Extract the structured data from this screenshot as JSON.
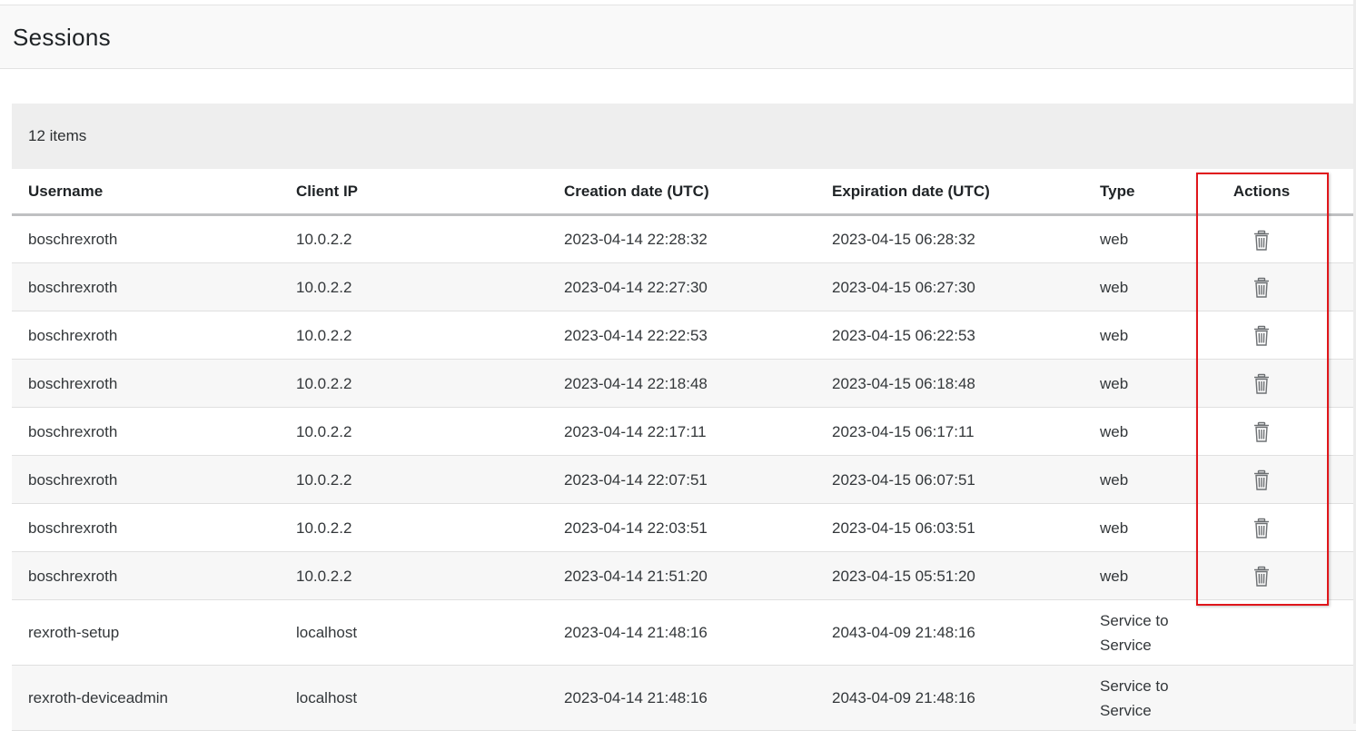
{
  "page": {
    "title": "Sessions"
  },
  "table": {
    "item_count": "12 items",
    "columns": [
      "Username",
      "Client IP",
      "Creation date (UTC)",
      "Expiration date (UTC)",
      "Type",
      "Actions"
    ],
    "rows": [
      {
        "username": "boschrexroth",
        "client_ip": "10.0.2.2",
        "created": "2023-04-14 22:28:32",
        "expires": "2023-04-15 06:28:32",
        "type": "web",
        "delete": true
      },
      {
        "username": "boschrexroth",
        "client_ip": "10.0.2.2",
        "created": "2023-04-14 22:27:30",
        "expires": "2023-04-15 06:27:30",
        "type": "web",
        "delete": true
      },
      {
        "username": "boschrexroth",
        "client_ip": "10.0.2.2",
        "created": "2023-04-14 22:22:53",
        "expires": "2023-04-15 06:22:53",
        "type": "web",
        "delete": true
      },
      {
        "username": "boschrexroth",
        "client_ip": "10.0.2.2",
        "created": "2023-04-14 22:18:48",
        "expires": "2023-04-15 06:18:48",
        "type": "web",
        "delete": true
      },
      {
        "username": "boschrexroth",
        "client_ip": "10.0.2.2",
        "created": "2023-04-14 22:17:11",
        "expires": "2023-04-15 06:17:11",
        "type": "web",
        "delete": true
      },
      {
        "username": "boschrexroth",
        "client_ip": "10.0.2.2",
        "created": "2023-04-14 22:07:51",
        "expires": "2023-04-15 06:07:51",
        "type": "web",
        "delete": true
      },
      {
        "username": "boschrexroth",
        "client_ip": "10.0.2.2",
        "created": "2023-04-14 22:03:51",
        "expires": "2023-04-15 06:03:51",
        "type": "web",
        "delete": true
      },
      {
        "username": "boschrexroth",
        "client_ip": "10.0.2.2",
        "created": "2023-04-14 21:51:20",
        "expires": "2023-04-15 05:51:20",
        "type": "web",
        "delete": true
      },
      {
        "username": "rexroth-setup",
        "client_ip": "localhost",
        "created": "2023-04-14 21:48:16",
        "expires": "2043-04-09 21:48:16",
        "type": "Service to Service",
        "delete": false
      },
      {
        "username": "rexroth-deviceadmin",
        "client_ip": "localhost",
        "created": "2023-04-14 21:48:16",
        "expires": "2043-04-09 21:48:16",
        "type": "Service to Service",
        "delete": false
      }
    ]
  },
  "icons": {
    "delete": "trash-icon"
  },
  "colors": {
    "highlight_border": "#e0161b",
    "items_bar_bg": "#eeeeee",
    "header_bg": "#f9f9f9",
    "icon": "#6d7073"
  }
}
